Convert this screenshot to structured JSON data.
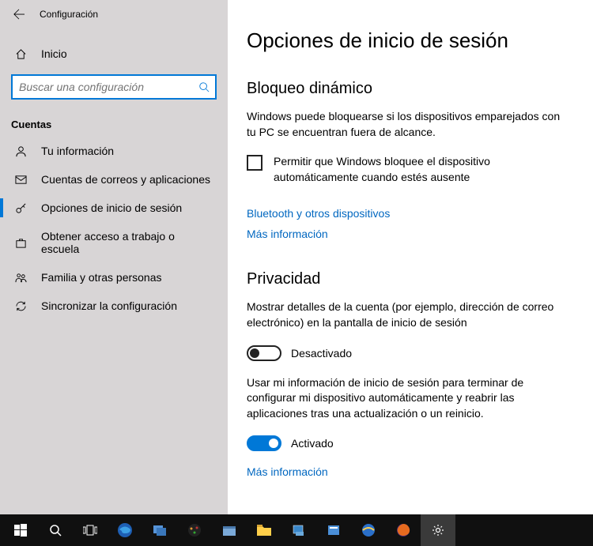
{
  "titlebar": {
    "title": "Configuración"
  },
  "home_label": "Inicio",
  "search": {
    "placeholder": "Buscar una configuración"
  },
  "section_label": "Cuentas",
  "nav": [
    {
      "label": "Tu información"
    },
    {
      "label": "Cuentas de correos y aplicaciones"
    },
    {
      "label": "Opciones de inicio de sesión"
    },
    {
      "label": "Obtener acceso a trabajo o escuela"
    },
    {
      "label": "Familia y otras personas"
    },
    {
      "label": "Sincronizar la configuración"
    }
  ],
  "main": {
    "page_title": "Opciones de inicio de sesión",
    "dynamic_lock": {
      "heading": "Bloqueo dinámico",
      "description": "Windows puede bloquearse si los dispositivos emparejados con tu PC se encuentran fuera de alcance.",
      "checkbox_label": "Permitir que Windows bloquee el dispositivo automáticamente cuando estés ausente",
      "link_bluetooth": "Bluetooth y otros dispositivos",
      "link_more": "Más información"
    },
    "privacy": {
      "heading": "Privacidad",
      "desc1": "Mostrar detalles de la cuenta (por ejemplo, dirección de correo electrónico) en la pantalla de inicio de sesión",
      "toggle1_state": "Desactivado",
      "desc2": "Usar mi información de inicio de sesión para terminar de configurar mi dispositivo automáticamente y reabrir las aplicaciones tras una actualización o un reinicio.",
      "toggle2_state": "Activado",
      "link_more": "Más información"
    }
  }
}
